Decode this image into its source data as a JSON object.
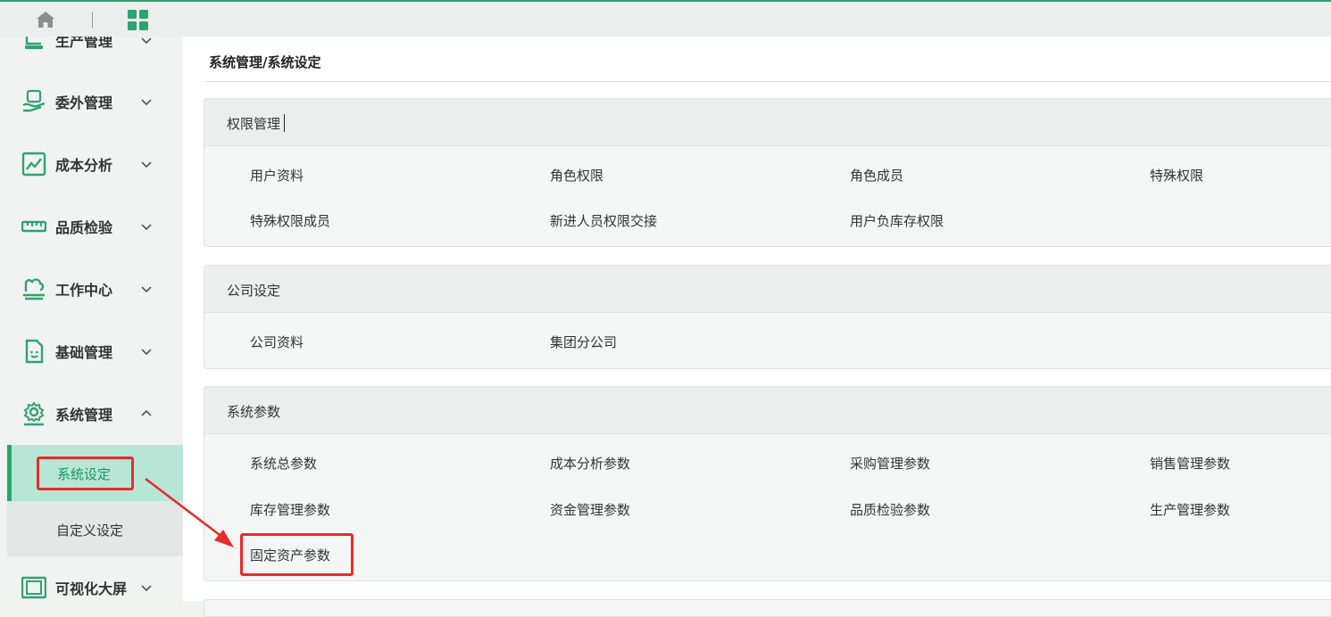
{
  "topbar": {
    "home_icon": "home-icon",
    "apps_icon": "apps-grid-icon"
  },
  "sidebar": {
    "items": [
      {
        "label": "生产管理",
        "icon": "production-icon"
      },
      {
        "label": "委外管理",
        "icon": "outsource-icon"
      },
      {
        "label": "成本分析",
        "icon": "chart-icon"
      },
      {
        "label": "品质检验",
        "icon": "ruler-icon"
      },
      {
        "label": "工作中心",
        "icon": "workcenter-icon"
      },
      {
        "label": "基础管理",
        "icon": "document-icon"
      },
      {
        "label": "系统管理",
        "icon": "gear-icon"
      },
      {
        "label": "可视化大屏",
        "icon": "screen-icon"
      }
    ],
    "sub_items": [
      {
        "label": "系统设定",
        "active": true
      },
      {
        "label": "自定义设定",
        "active": false
      }
    ]
  },
  "breadcrumb": "系统管理/系统设定",
  "cards": [
    {
      "title": "权限管理",
      "links": [
        "用户资料",
        "角色权限",
        "角色成员",
        "特殊权限",
        "特殊权限成员",
        "新进人员权限交接",
        "用户负库存权限"
      ]
    },
    {
      "title": "公司设定",
      "links": [
        "公司资料",
        "集团分公司"
      ]
    },
    {
      "title": "系统参数",
      "links": [
        "系统总参数",
        "成本分析参数",
        "采购管理参数",
        "销售管理参数",
        "库存管理参数",
        "资金管理参数",
        "品质检验参数",
        "生产管理参数",
        "固定资产参数"
      ]
    }
  ],
  "colors": {
    "accent": "#2fa36f",
    "highlight": "#e82a2a",
    "active_bg": "#b7e6d6"
  }
}
